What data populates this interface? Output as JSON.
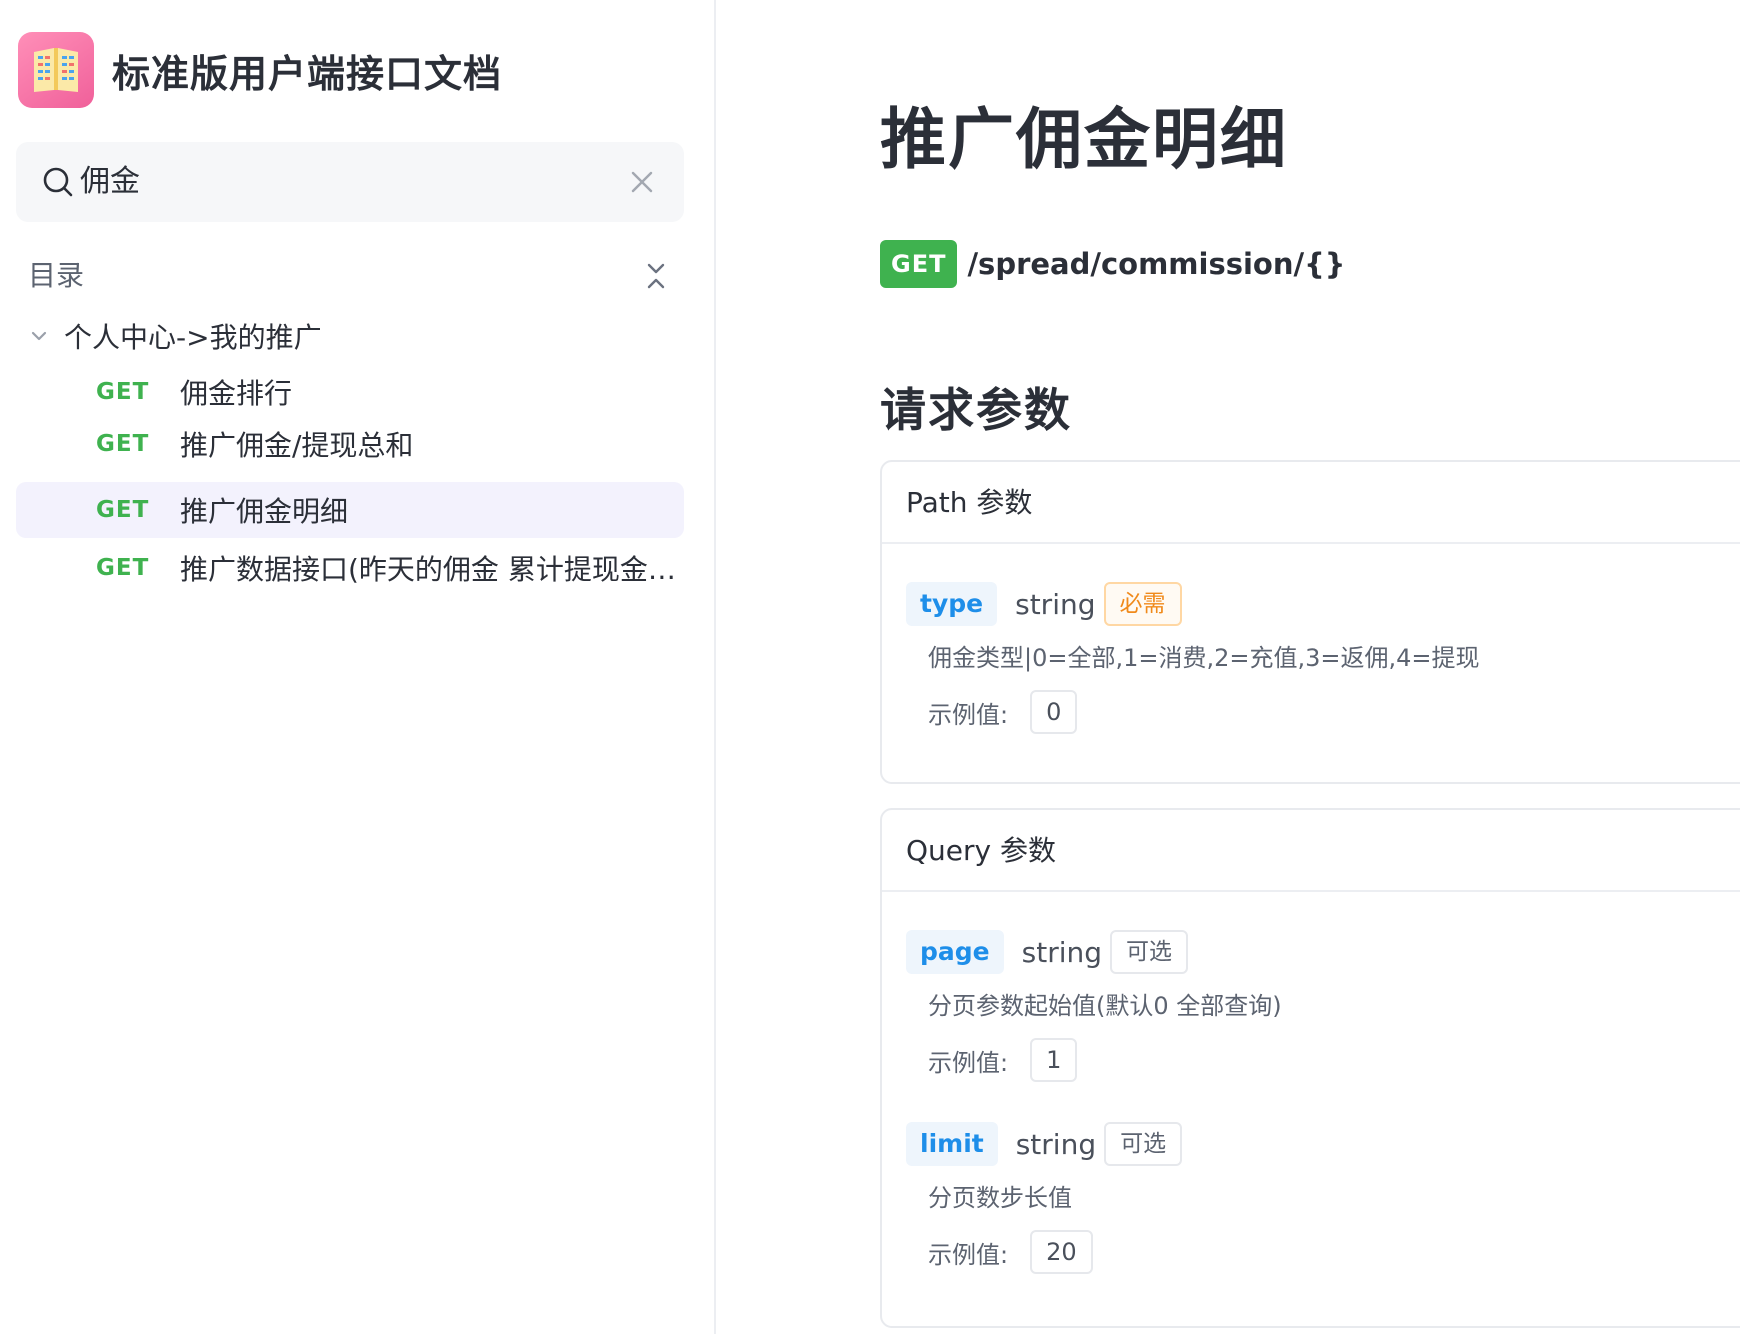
{
  "brand": {
    "title": "标准版用户端接口文档",
    "logo_icon": "book-icon"
  },
  "search": {
    "query": "佣金"
  },
  "toc": {
    "title": "目录",
    "group": {
      "label": "个人中心->我的推广"
    },
    "items": [
      {
        "method": "GET",
        "label": "佣金排行"
      },
      {
        "method": "GET",
        "label": "推广佣金/提现总和"
      },
      {
        "method": "GET",
        "label": "推广佣金明细"
      },
      {
        "method": "GET",
        "label": "推广数据接口(昨天的佣金 累计提现金额 当前佣金)"
      }
    ]
  },
  "main": {
    "title": "推广佣金明细",
    "method": "GET",
    "path": "/spread/commission/{}",
    "request_section": "请求参数",
    "path_params": {
      "header": "Path 参数",
      "params": [
        {
          "name": "type",
          "type": "string",
          "tag": "必需",
          "description": "佣金类型|0=全部,1=消费,2=充值,3=返佣,4=提现",
          "example_label": "示例值:",
          "example": "0"
        }
      ]
    },
    "query_params": {
      "header": "Query 参数",
      "params": [
        {
          "name": "page",
          "type": "string",
          "tag": "可选",
          "description": "分页参数起始值(默认0 全部查询)",
          "example_label": "示例值:",
          "example": "1"
        },
        {
          "name": "limit",
          "type": "string",
          "tag": "可选",
          "description": "分页数步长值",
          "example_label": "示例值:",
          "example": "20"
        }
      ]
    }
  },
  "colors": {
    "get": "#3fb24f",
    "param_name": "#1e8ee9",
    "required": "#f08a1b",
    "active_bg": "#f3f2fd"
  }
}
